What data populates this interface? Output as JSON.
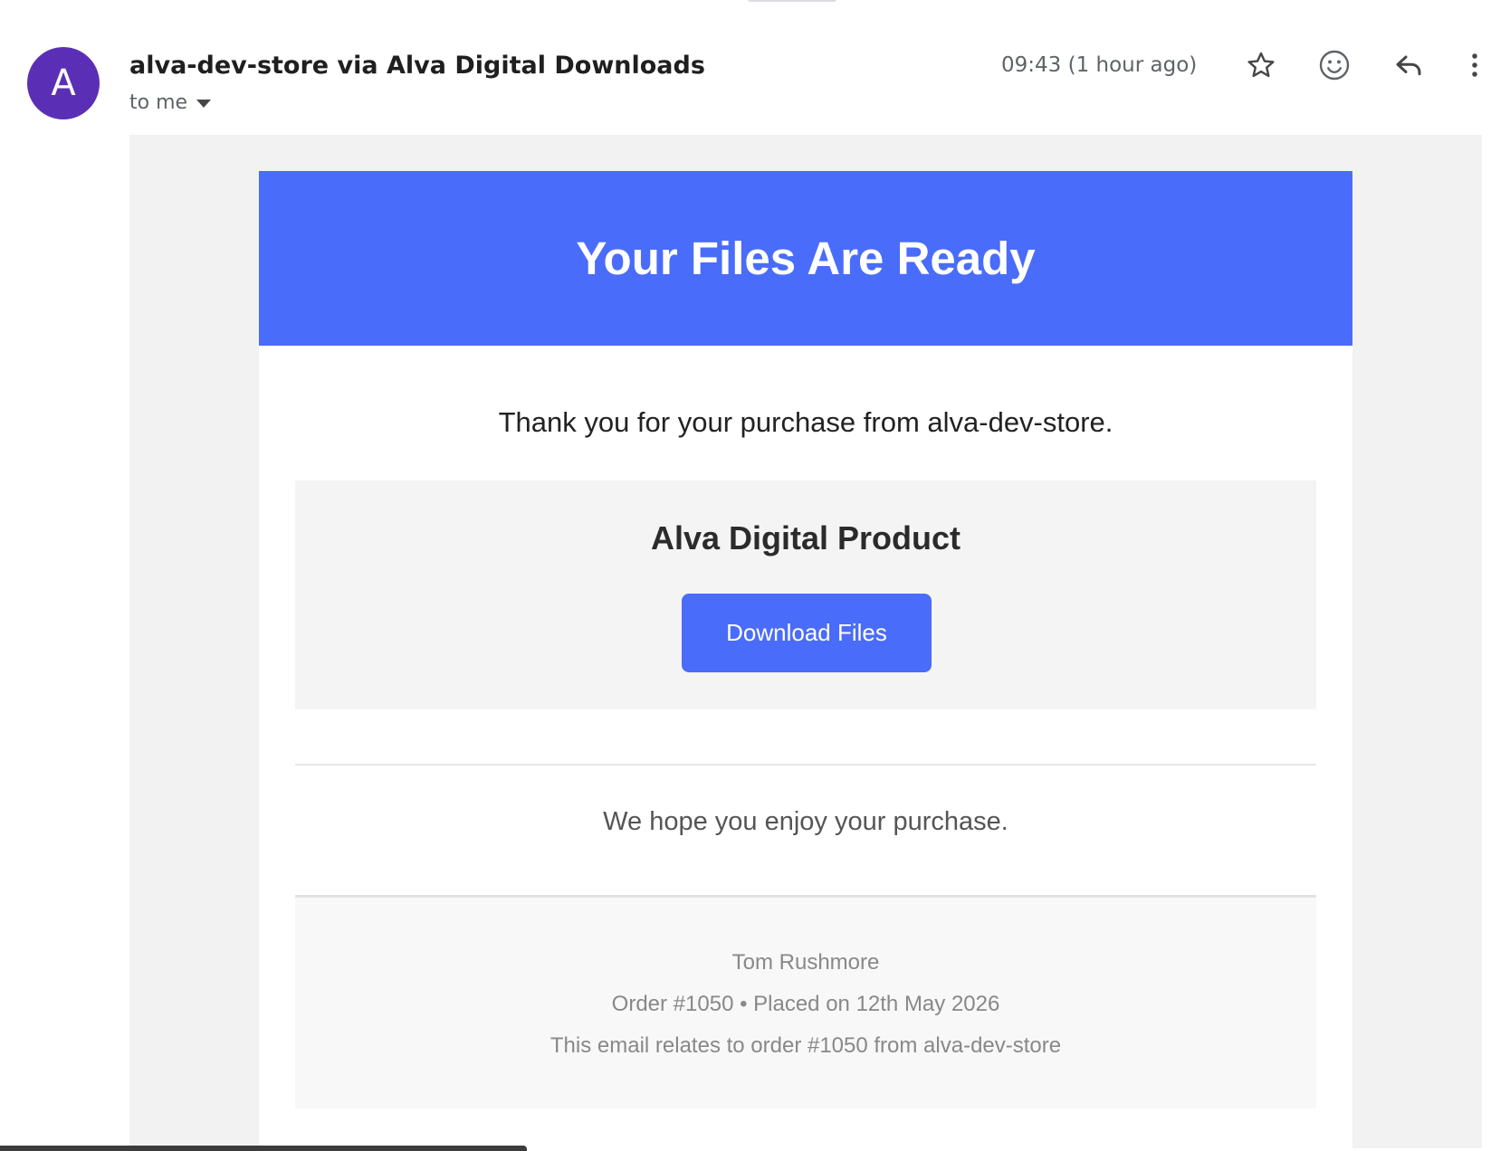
{
  "header": {
    "avatar_letter": "A",
    "sender": "alva-dev-store via Alva Digital Downloads",
    "recipient": "to me",
    "timestamp": "09:43 (1 hour ago)"
  },
  "email": {
    "banner_title": "Your Files Are Ready",
    "thanks_text": "Thank you for your purchase from alva-dev-store.",
    "product_name": "Alva Digital Product",
    "download_label": "Download Files",
    "enjoy_text": "We hope you enjoy your purchase.",
    "footer": {
      "customer": "Tom Rushmore",
      "order_line": "Order #1050 • Placed on 12th May 2026",
      "relates_line": "This email relates to order #1050 from alva-dev-store"
    }
  },
  "colors": {
    "brand_blue": "#4a6cfa",
    "avatar_purple": "#5b2fb5"
  },
  "icons": [
    "star-icon",
    "emoji-icon",
    "reply-icon",
    "more-vert-icon",
    "chevron-down-icon"
  ]
}
